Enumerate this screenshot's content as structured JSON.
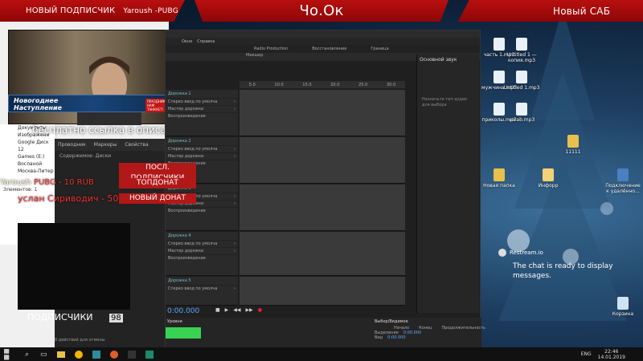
{
  "overlay": {
    "new_sub_label": "НОВЫЙ ПОДПИСЧИК",
    "new_sub_name": "Yaroush -PUBG",
    "chat_tag": "Чо.Ок",
    "new_sab": "Новый САБ",
    "stream_banner_title": "Новогоднее Наступление",
    "stream_banner_button": "ПРАЗДНИК К НАМ ТАНКУЕТ!",
    "ticker": "бесплатно ссылка в описании",
    "labels": [
      "ПОСЛ. ПОДПИСЧИКИ",
      "ТОПДОНАТ",
      "НОВЫЙ ДОНАТ"
    ],
    "donor_name": "Yaroush",
    "donor_amount": "PUBG - 10 RUB",
    "donor2": "услан Сириводич - 50",
    "subs_label": "ПОДПИСЧИКИ",
    "subs_count": "98",
    "restream_name": "Restream.io",
    "restream_msg": "The chat is ready to display messages."
  },
  "desktop_icons": [
    {
      "label": "часть 1.mp3"
    },
    {
      "label": "Untitled 1 — копия.mp3"
    },
    {
      "label": "мужчина.mp3"
    },
    {
      "label": "Untitled 1.mp3"
    },
    {
      "label": "приколы.mp3"
    },
    {
      "label": "vorab.mp3"
    },
    {
      "label": "11111"
    },
    {
      "label": "Новая папка"
    },
    {
      "label": "Инфорр"
    },
    {
      "label": "Подключение к удалённо..."
    },
    {
      "label": "Корзина"
    }
  ],
  "explorer": {
    "items": [
      "Документы",
      "Изображени",
      "Google Диск",
      "12",
      "Games (E:)",
      "Восланой",
      "Москва-Питер"
    ],
    "bottom": "Элементов: 1"
  },
  "audition": {
    "menu": [
      "Окно",
      "Справка"
    ],
    "tabs": [
      "Микшер"
    ],
    "workspaces": [
      "Radio Production",
      "Восстановление",
      "Граница"
    ],
    "track_names": [
      "Дорожка 1",
      "Дорожка 2",
      "Дорожка 3",
      "Дорожка 4",
      "Дорожка 5"
    ],
    "track_rows": [
      "Стерео ввод по умолча",
      "Мастер дорожки",
      "Воспроизведение"
    ],
    "panel_title": "Основной звук",
    "panel_hint": "Назначьте тип аудио для выбора",
    "time": "0:00.000",
    "ruler": [
      "5.0",
      "10.0",
      "15.0",
      "20.0",
      "25.0",
      "30.0"
    ],
    "levels_title": "Уровни",
    "sel_title": "Выбор/Видимое",
    "sel_cols": [
      "Начало",
      "Конец",
      "Продолжительность"
    ],
    "sel_rows": [
      "Выделение",
      "Вид"
    ],
    "sel_value": "0:00.000",
    "status": "8 действий для отмены"
  },
  "left_panel": {
    "tabs": [
      "Проводник",
      "Маркеры",
      "Свойства"
    ],
    "sub": "Содержимое: Диски"
  },
  "taskbar": {
    "lang": "ENG",
    "time": "22:46",
    "date": "14.01.2019"
  },
  "colors": {
    "red": "#b21818",
    "green": "#39d353",
    "audition_bg": "#1f1f1f"
  }
}
